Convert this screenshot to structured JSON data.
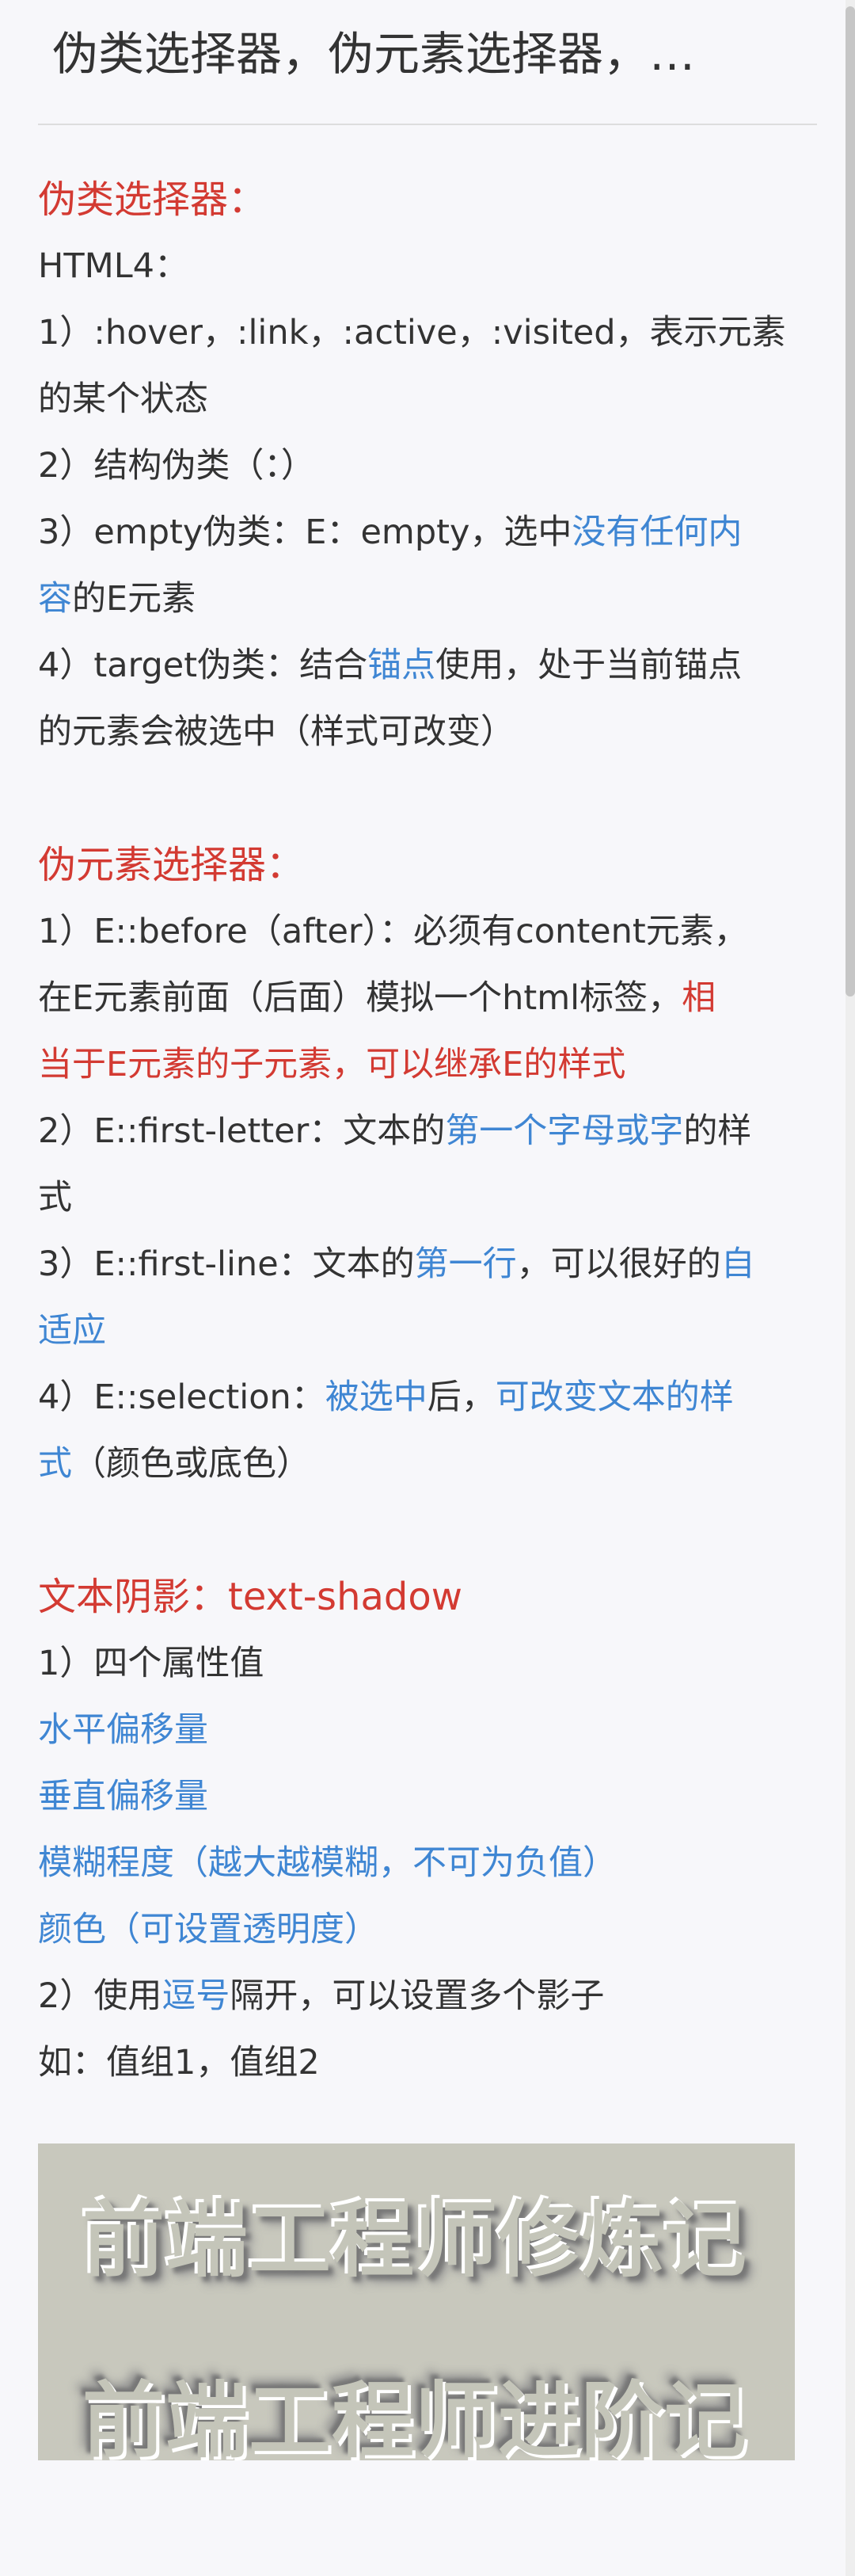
{
  "article": {
    "title": "伪类选择器，伪元素选择器，…"
  },
  "sections": {
    "pseudo_class": {
      "heading": "伪类选择器：",
      "html4": "HTML4：",
      "item1_line1": "1）:hover，:link，:active，:visited，表示元素",
      "item1_line2": "的某个状态",
      "item2": "2）结构伪类（：）",
      "item3_line1_pre": "3）empty伪类：E：empty，选中",
      "item3_line1_highlight": "没有任何内",
      "item3_line2_highlight": "容",
      "item3_line2_post": "的E元素",
      "item4_line1_pre": "4）target伪类：结合",
      "item4_line1_highlight": "锚点",
      "item4_line1_post": "使用，处于当前锚点",
      "item4_line2": "的元素会被选中（样式可改变）"
    },
    "pseudo_element": {
      "heading": "伪元素选择器：",
      "item1_line1": "1）E::before（after）：必须有content元素，",
      "item1_line2_pre": "在E元素前面（后面）模拟一个html标签，",
      "item1_line2_red": "相",
      "item1_line3_red": "当于E元素的子元素，可以继承E的样式",
      "item2_line1_pre": "2）E::first-letter：文本的",
      "item2_line1_highlight": "第一个字母或字",
      "item2_line1_post": "的样",
      "item2_line2": "式",
      "item3_line1_pre": "3）E::first-line：文本的",
      "item3_line1_highlight": "第一行",
      "item3_line1_mid": "，可以很好的",
      "item3_line1_highlight2": "自",
      "item3_line2_highlight": "适应",
      "item4_line1_pre": "4）E::selection：",
      "item4_line1_highlight": "被选中",
      "item4_line1_mid": "后，",
      "item4_line1_highlight2": "可改变文本的样",
      "item4_line2_highlight": "式",
      "item4_line2_post": "（颜色或底色）"
    },
    "text_shadow": {
      "heading": "文本阴影：text-shadow",
      "item1": "1）四个属性值",
      "value1": "水平偏移量",
      "value2": "垂直偏移量",
      "value3": "模糊程度（越大越模糊，不可为负值）",
      "value4": "颜色（可设置透明度）",
      "item2_pre": "2）使用",
      "item2_highlight": "逗号",
      "item2_post": "隔开，可以设置多个影子",
      "example": "如：值组1，值组2"
    }
  },
  "demo": {
    "text_1": "前端工程师修炼记",
    "text_2": "前端工程师进阶记"
  },
  "colors": {
    "heading_red": "#d33a32",
    "highlight_blue": "#3f86d3",
    "body_text": "#333333",
    "background": "#f7f7fa",
    "demo_background": "#c8c8bd"
  }
}
